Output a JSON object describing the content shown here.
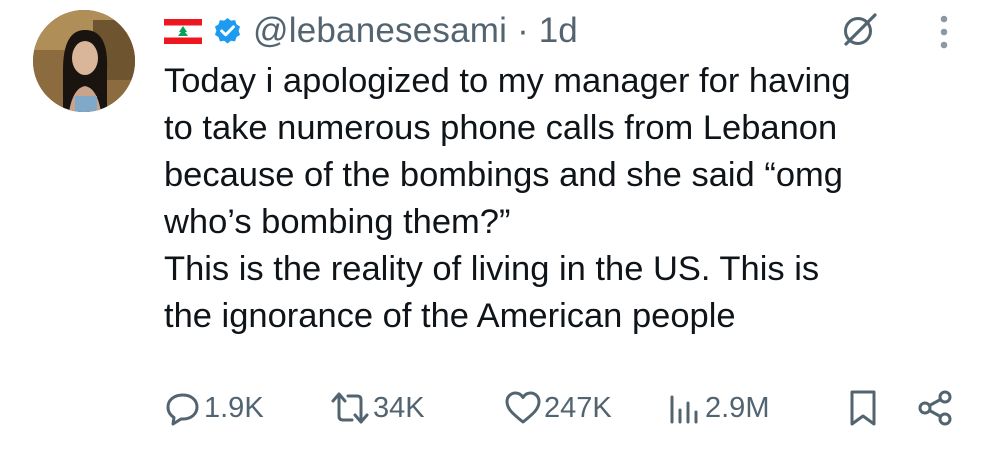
{
  "post": {
    "author_handle": "@lebanesesami",
    "separator": "·",
    "time": "1d",
    "text_lines": [
      "Today i apologized to my manager for having",
      "to take numerous phone calls from Lebanon",
      "because of the bombings and she said “omg",
      "who’s bombing them?”",
      "This is the reality of living in the US. This is",
      "the ignorance of the American people"
    ],
    "flag_icon": "lebanon-flag-icon",
    "verified_icon": "verified-badge-icon"
  },
  "actions": {
    "replies": "1.9K",
    "reposts": "34K",
    "likes": "247K",
    "views": "2.9M"
  },
  "colors": {
    "text": "#0f1419",
    "secondary": "#536471",
    "verified_blue": "#1d9bf0",
    "flag_red": "#ee161f",
    "flag_green": "#00a651"
  }
}
